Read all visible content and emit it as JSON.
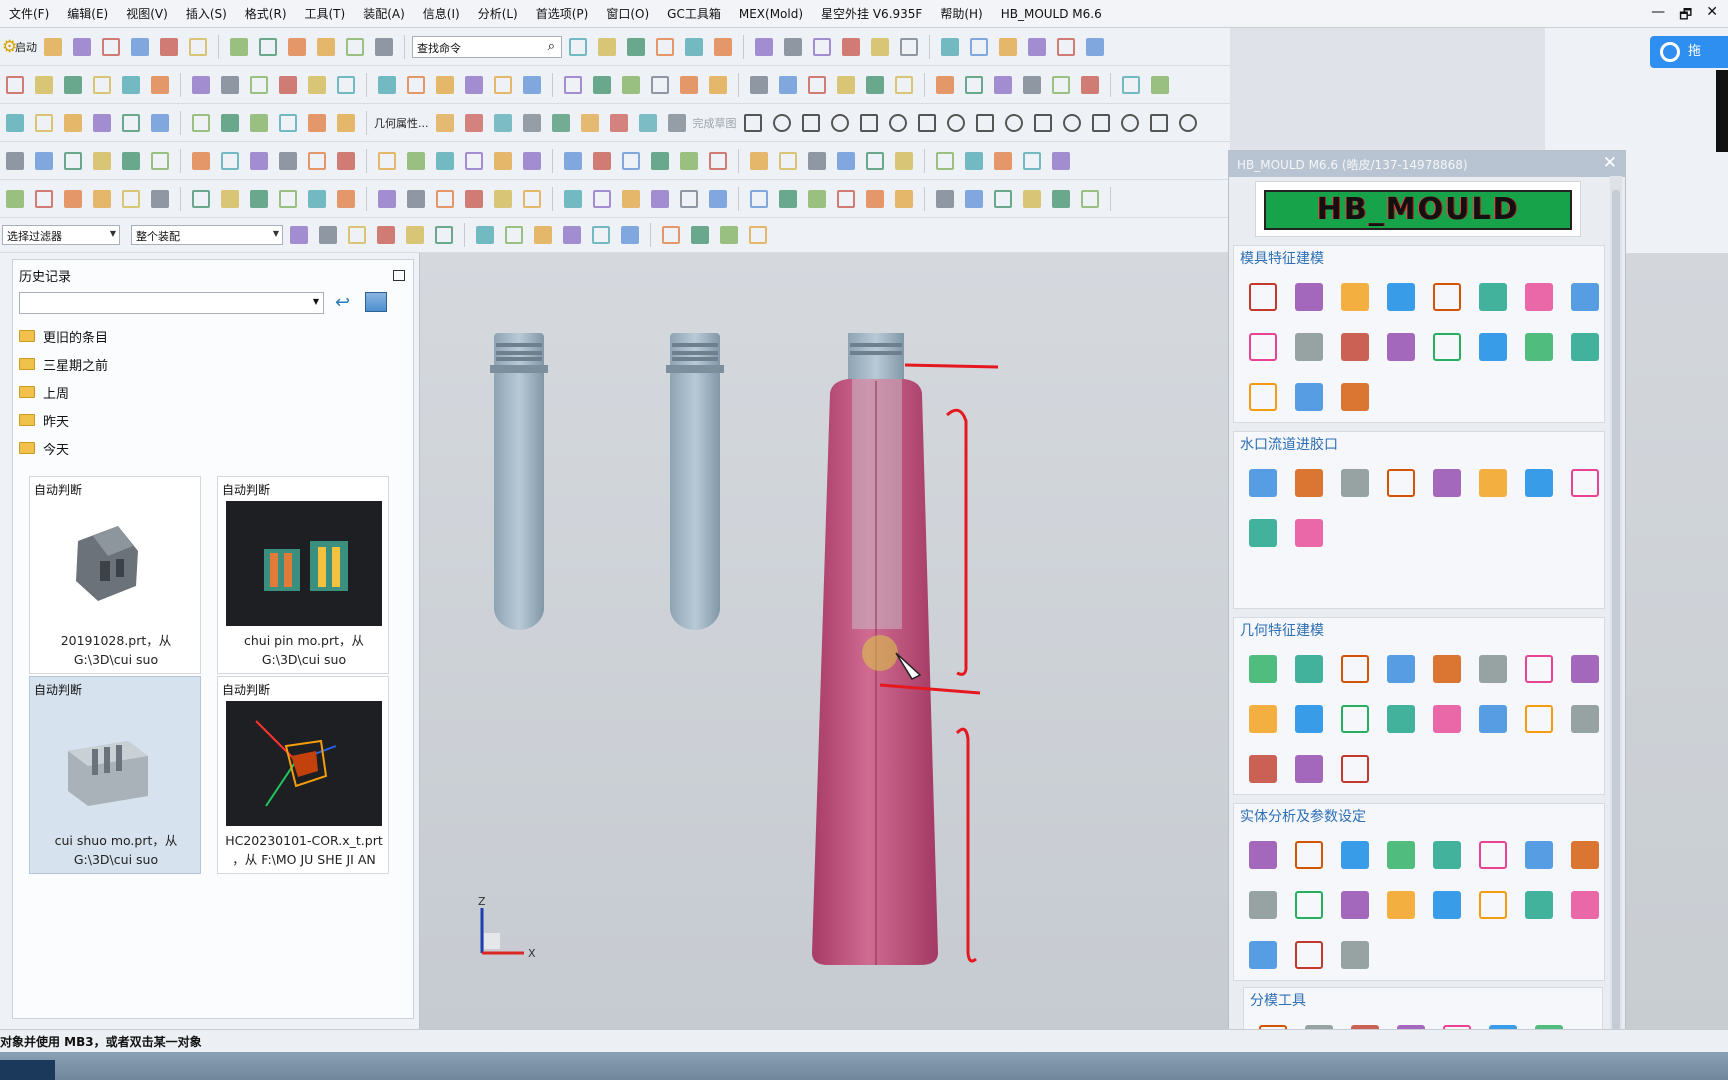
{
  "menus": [
    "文件(F)",
    "编辑(E)",
    "视图(V)",
    "插入(S)",
    "格式(R)",
    "工具(T)",
    "装配(A)",
    "信息(I)",
    "分析(L)",
    "首选项(P)",
    "窗口(O)",
    "GC工具箱",
    "MEX(Mold)",
    "星空外挂 V6.935F",
    "帮助(H)",
    "HB_MOULD M6.6"
  ],
  "window_controls": [
    "—",
    "🗗",
    "✕"
  ],
  "toolbar": {
    "start_label": "启动",
    "command_search_placeholder": "查找命令",
    "geom_label": "几何属性...",
    "face_label": "完成草图",
    "selection_filter": "选择过滤器",
    "assembly_scope": "整个装配"
  },
  "cloud": {
    "label": "拖"
  },
  "history": {
    "title": "历史记录",
    "folders": [
      "更旧的条目",
      "三星期之前",
      "上周",
      "昨天",
      "今天"
    ],
    "thumbs": [
      {
        "label": "自动判断",
        "name1": "20191028.prt，从",
        "name2": "G:\\3D\\cui suo"
      },
      {
        "label": "自动判断",
        "name1": "chui pin mo.prt，从",
        "name2": "G:\\3D\\cui suo"
      },
      {
        "label": "自动判断",
        "name1": "cui shuo mo.prt，从",
        "name2": "G:\\3D\\cui suo"
      },
      {
        "label": "自动判断",
        "name1": "HC20230101-COR.x_t.prt",
        "name2": "，从 F:\\MO JU SHE JI AN"
      }
    ]
  },
  "viewport": {
    "axis_z": "Z",
    "axis_x": "X"
  },
  "panel": {
    "title": "HB_MOULD M6.6 (皓皮/137-14978868)",
    "logo": "HB_MOULD",
    "sections": [
      "模具特征建模",
      "水口流道进胶口",
      "几何特征建模",
      "实体分析及参数设定",
      "分模工具"
    ]
  },
  "status": {
    "text": "对象并使用 MB3，或者双击某一对象"
  },
  "colors": {
    "accent": "#2f6fb5",
    "cloud": "#2f8ff0",
    "part_pink": "#c34d7a",
    "part_grey": "#9eb3c2",
    "annotation_red": "#e5181f",
    "logo_green": "#16a34a"
  },
  "icons": {
    "close": "close-icon",
    "undo": "undo-icon",
    "image": "image-icon",
    "folder": "folder-icon",
    "cloud": "cloud-icon"
  }
}
